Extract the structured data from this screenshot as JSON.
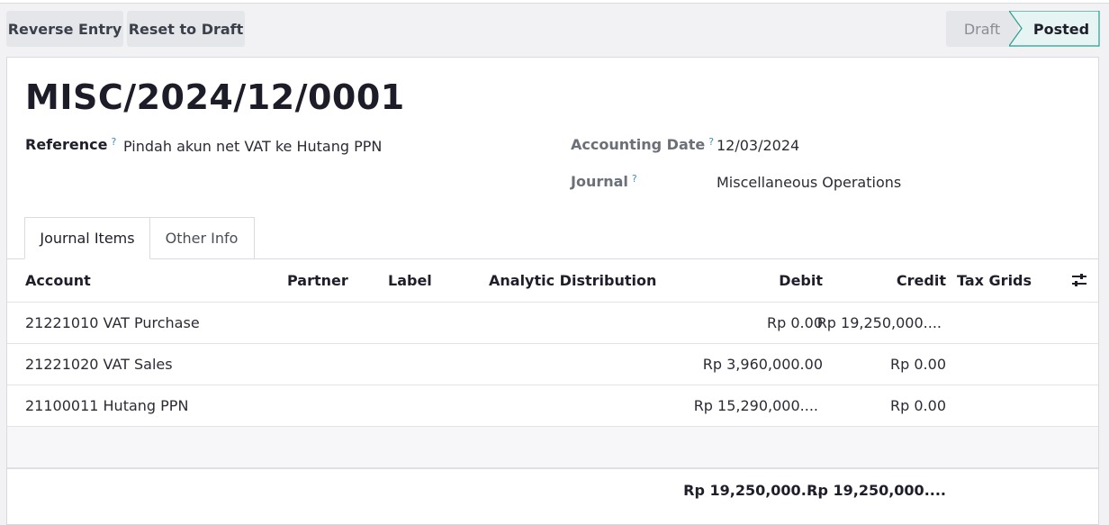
{
  "toolbar": {
    "reverse_label": "Reverse Entry",
    "reset_label": "Reset to Draft"
  },
  "status": {
    "steps": [
      "Draft",
      "Posted"
    ],
    "active": "Posted"
  },
  "entry": {
    "title": "MISC/2024/12/0001",
    "reference_label": "Reference",
    "reference_value": "Pindah akun net VAT ke Hutang PPN",
    "accounting_date_label": "Accounting Date",
    "accounting_date_value": "12/03/2024",
    "journal_label": "Journal",
    "journal_value": "Miscellaneous Operations",
    "help_mark": "?"
  },
  "tabs": [
    {
      "label": "Journal Items",
      "active": true
    },
    {
      "label": "Other Info",
      "active": false
    }
  ],
  "table": {
    "columns": [
      "Account",
      "Partner",
      "Label",
      "Analytic Distribution",
      "Debit",
      "Credit",
      "Tax Grids"
    ],
    "rows": [
      {
        "account": "21221010 VAT Purchase",
        "partner": "",
        "label": "",
        "analytic": "",
        "debit": "Rp 0.00",
        "credit": "Rp 19,250,000....",
        "tax_grids": ""
      },
      {
        "account": "21221020 VAT Sales",
        "partner": "",
        "label": "",
        "analytic": "",
        "debit": "Rp 3,960,000.00",
        "credit": "Rp 0.00",
        "tax_grids": ""
      },
      {
        "account": "21100011 Hutang PPN",
        "partner": "",
        "label": "",
        "analytic": "",
        "debit": "Rp 15,290,000....",
        "credit": "Rp 0.00",
        "tax_grids": ""
      }
    ],
    "totals": {
      "debit": "Rp 19,250,000....",
      "credit": "Rp 19,250,000...."
    }
  },
  "icons": {
    "column_settings": "sliders-icon"
  },
  "colors": {
    "status_active_bg": "#e6f4f3",
    "status_active_border": "#2a9d8f",
    "help_mark": "#3e8fbf"
  }
}
